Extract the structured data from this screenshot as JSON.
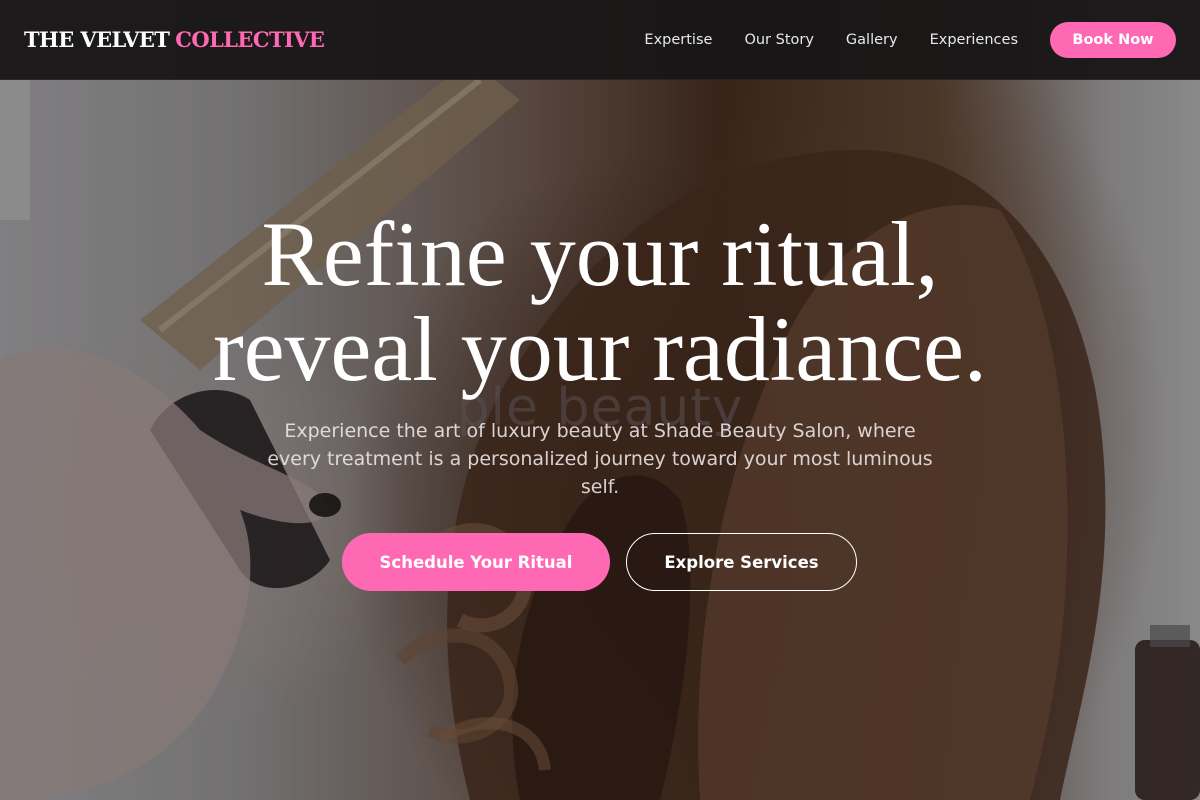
{
  "brand": {
    "name_part1": "THE VELVET",
    "name_part2": "COLLECTIVE",
    "accent_color": "#ff69b4"
  },
  "nav": {
    "links": [
      "Expertise",
      "Our Story",
      "Gallery",
      "Experiences"
    ],
    "book_label": "Book Now"
  },
  "hero": {
    "headline_line1": "Refine your ritual,",
    "headline_line2": "reveal your radiance.",
    "background_partial_text": "ple beauty",
    "subtext": "Experience the art of luxury beauty at Shade Beauty Salon, where every treatment is a personalized journey toward your most luminous self.",
    "primary_cta": "Schedule Your Ritual",
    "secondary_cta": "Explore Services",
    "background_image": "hair-styling-curling-iron-photo"
  }
}
